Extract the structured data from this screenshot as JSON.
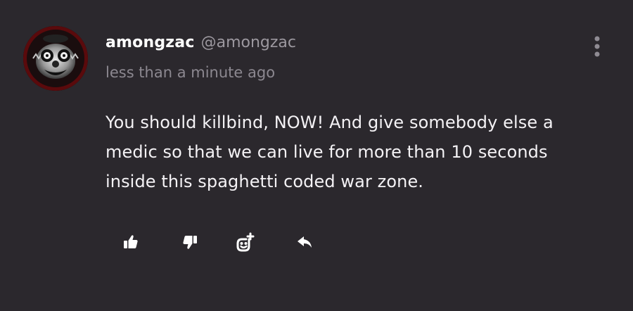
{
  "comment": {
    "author": {
      "name": "amongzac",
      "handle": "@amongzac",
      "avatar_icon": "clown-face-avatar"
    },
    "timestamp": "less than a minute ago",
    "body_lines": [
      "You should killbind, NOW! And give somebody else a",
      "medic so that we can live for more than 10 seconds",
      "inside this spaghetti coded war zone."
    ],
    "actions": [
      {
        "icon": "thumbs-up-icon",
        "action": "like"
      },
      {
        "icon": "thumbs-down-icon",
        "action": "dislike"
      },
      {
        "icon": "add-reaction-icon",
        "action": "react"
      },
      {
        "icon": "reply-icon",
        "action": "reply"
      }
    ],
    "menu_icon": "more-vertical-icon"
  },
  "colors": {
    "background": "#2b282d",
    "text": "#f4f2f5",
    "muted": "#9c989f",
    "avatar_accent": "#7a0d10"
  }
}
